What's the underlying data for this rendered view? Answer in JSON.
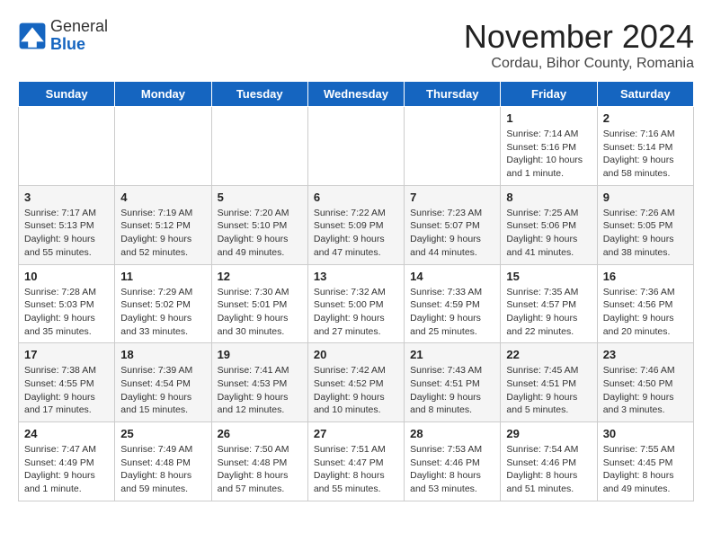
{
  "logo": {
    "general": "General",
    "blue": "Blue"
  },
  "title": "November 2024",
  "location": "Cordau, Bihor County, Romania",
  "days_of_week": [
    "Sunday",
    "Monday",
    "Tuesday",
    "Wednesday",
    "Thursday",
    "Friday",
    "Saturday"
  ],
  "weeks": [
    [
      {
        "day": "",
        "info": ""
      },
      {
        "day": "",
        "info": ""
      },
      {
        "day": "",
        "info": ""
      },
      {
        "day": "",
        "info": ""
      },
      {
        "day": "",
        "info": ""
      },
      {
        "day": "1",
        "info": "Sunrise: 7:14 AM\nSunset: 5:16 PM\nDaylight: 10 hours and 1 minute."
      },
      {
        "day": "2",
        "info": "Sunrise: 7:16 AM\nSunset: 5:14 PM\nDaylight: 9 hours and 58 minutes."
      }
    ],
    [
      {
        "day": "3",
        "info": "Sunrise: 7:17 AM\nSunset: 5:13 PM\nDaylight: 9 hours and 55 minutes."
      },
      {
        "day": "4",
        "info": "Sunrise: 7:19 AM\nSunset: 5:12 PM\nDaylight: 9 hours and 52 minutes."
      },
      {
        "day": "5",
        "info": "Sunrise: 7:20 AM\nSunset: 5:10 PM\nDaylight: 9 hours and 49 minutes."
      },
      {
        "day": "6",
        "info": "Sunrise: 7:22 AM\nSunset: 5:09 PM\nDaylight: 9 hours and 47 minutes."
      },
      {
        "day": "7",
        "info": "Sunrise: 7:23 AM\nSunset: 5:07 PM\nDaylight: 9 hours and 44 minutes."
      },
      {
        "day": "8",
        "info": "Sunrise: 7:25 AM\nSunset: 5:06 PM\nDaylight: 9 hours and 41 minutes."
      },
      {
        "day": "9",
        "info": "Sunrise: 7:26 AM\nSunset: 5:05 PM\nDaylight: 9 hours and 38 minutes."
      }
    ],
    [
      {
        "day": "10",
        "info": "Sunrise: 7:28 AM\nSunset: 5:03 PM\nDaylight: 9 hours and 35 minutes."
      },
      {
        "day": "11",
        "info": "Sunrise: 7:29 AM\nSunset: 5:02 PM\nDaylight: 9 hours and 33 minutes."
      },
      {
        "day": "12",
        "info": "Sunrise: 7:30 AM\nSunset: 5:01 PM\nDaylight: 9 hours and 30 minutes."
      },
      {
        "day": "13",
        "info": "Sunrise: 7:32 AM\nSunset: 5:00 PM\nDaylight: 9 hours and 27 minutes."
      },
      {
        "day": "14",
        "info": "Sunrise: 7:33 AM\nSunset: 4:59 PM\nDaylight: 9 hours and 25 minutes."
      },
      {
        "day": "15",
        "info": "Sunrise: 7:35 AM\nSunset: 4:57 PM\nDaylight: 9 hours and 22 minutes."
      },
      {
        "day": "16",
        "info": "Sunrise: 7:36 AM\nSunset: 4:56 PM\nDaylight: 9 hours and 20 minutes."
      }
    ],
    [
      {
        "day": "17",
        "info": "Sunrise: 7:38 AM\nSunset: 4:55 PM\nDaylight: 9 hours and 17 minutes."
      },
      {
        "day": "18",
        "info": "Sunrise: 7:39 AM\nSunset: 4:54 PM\nDaylight: 9 hours and 15 minutes."
      },
      {
        "day": "19",
        "info": "Sunrise: 7:41 AM\nSunset: 4:53 PM\nDaylight: 9 hours and 12 minutes."
      },
      {
        "day": "20",
        "info": "Sunrise: 7:42 AM\nSunset: 4:52 PM\nDaylight: 9 hours and 10 minutes."
      },
      {
        "day": "21",
        "info": "Sunrise: 7:43 AM\nSunset: 4:51 PM\nDaylight: 9 hours and 8 minutes."
      },
      {
        "day": "22",
        "info": "Sunrise: 7:45 AM\nSunset: 4:51 PM\nDaylight: 9 hours and 5 minutes."
      },
      {
        "day": "23",
        "info": "Sunrise: 7:46 AM\nSunset: 4:50 PM\nDaylight: 9 hours and 3 minutes."
      }
    ],
    [
      {
        "day": "24",
        "info": "Sunrise: 7:47 AM\nSunset: 4:49 PM\nDaylight: 9 hours and 1 minute."
      },
      {
        "day": "25",
        "info": "Sunrise: 7:49 AM\nSunset: 4:48 PM\nDaylight: 8 hours and 59 minutes."
      },
      {
        "day": "26",
        "info": "Sunrise: 7:50 AM\nSunset: 4:48 PM\nDaylight: 8 hours and 57 minutes."
      },
      {
        "day": "27",
        "info": "Sunrise: 7:51 AM\nSunset: 4:47 PM\nDaylight: 8 hours and 55 minutes."
      },
      {
        "day": "28",
        "info": "Sunrise: 7:53 AM\nSunset: 4:46 PM\nDaylight: 8 hours and 53 minutes."
      },
      {
        "day": "29",
        "info": "Sunrise: 7:54 AM\nSunset: 4:46 PM\nDaylight: 8 hours and 51 minutes."
      },
      {
        "day": "30",
        "info": "Sunrise: 7:55 AM\nSunset: 4:45 PM\nDaylight: 8 hours and 49 minutes."
      }
    ]
  ]
}
